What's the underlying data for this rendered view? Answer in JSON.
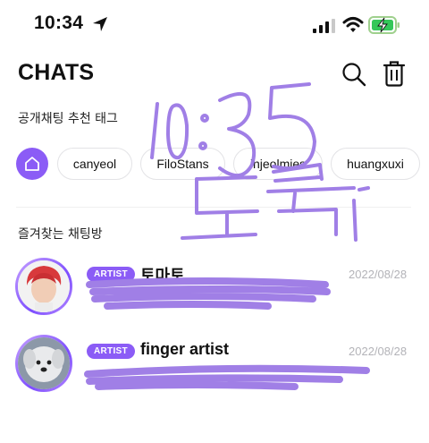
{
  "status_bar": {
    "time": "10:34"
  },
  "header": {
    "title": "CHATS",
    "icons": [
      "search-icon",
      "trash-icon"
    ]
  },
  "open_chat_section": {
    "label": "공개채팅 추천 태그"
  },
  "tags": [
    {
      "label": "canyeol"
    },
    {
      "label": "FiloStans"
    },
    {
      "label": "injeolmies"
    },
    {
      "label": "huangxuxi"
    }
  ],
  "favorites_section": {
    "label": "즐겨찾는 채팅방"
  },
  "chats": [
    {
      "badge": "ARTIST",
      "name": "토마토",
      "date": "2022/08/28",
      "preview": ""
    },
    {
      "badge": "ARTIST",
      "name": "finger artist",
      "date": "2022/08/28",
      "preview": ""
    }
  ],
  "handwriting": {
    "text": "10:35 도둑",
    "color": "#a07fe6"
  },
  "colors": {
    "accent": "#8b5cf6",
    "date_gray": "#b3b3b8",
    "redaction": "#a07fe6"
  }
}
